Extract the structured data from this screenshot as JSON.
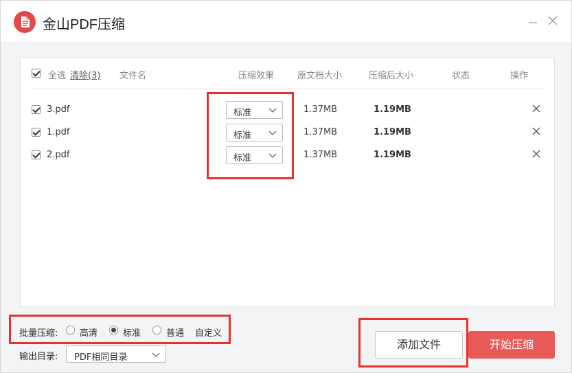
{
  "app": {
    "title": "金山PDF压缩",
    "accent_color": "#e14a4a",
    "highlight_color": "#e8312c",
    "icons": {
      "logo": "pdf-logo-icon",
      "minimize": "minimize-icon",
      "close": "close-icon",
      "remove": "close-x-icon",
      "dropdown": "chevron-down-icon"
    }
  },
  "table": {
    "select_all_label": "全选",
    "clear_label": "清除(3)",
    "headers": {
      "filename": "文件名",
      "effect": "压缩效果",
      "original_size": "原文档大小",
      "compressed_size": "压缩后大小",
      "status": "状态",
      "action": "操作"
    },
    "rows": [
      {
        "name": "3.pdf",
        "effect": "标准",
        "original": "1.37MB",
        "compressed": "1.19MB",
        "status": "",
        "checked": true
      },
      {
        "name": "1.pdf",
        "effect": "标准",
        "original": "1.37MB",
        "compressed": "1.19MB",
        "status": "",
        "checked": true
      },
      {
        "name": "2.pdf",
        "effect": "标准",
        "original": "1.37MB",
        "compressed": "1.19MB",
        "status": "",
        "checked": true
      }
    ]
  },
  "batch": {
    "label": "批量压缩:",
    "options": [
      "高清",
      "标准",
      "普通"
    ],
    "selected": "标准",
    "custom_label": "自定义"
  },
  "output": {
    "label": "输出目录:",
    "value": "PDF相同目录"
  },
  "buttons": {
    "add_files": "添加文件",
    "start": "开始压缩"
  }
}
